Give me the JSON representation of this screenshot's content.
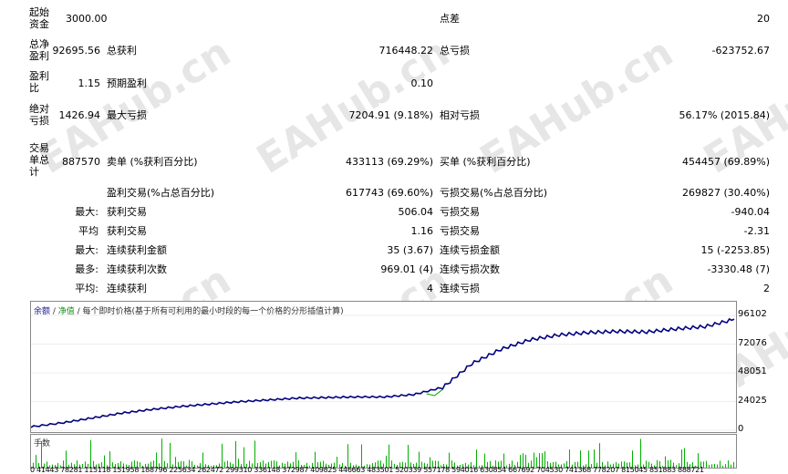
{
  "stats": {
    "initial_deposit_label": "起始资金",
    "initial_deposit": "3000.00",
    "spread_label": "点差",
    "spread": "20",
    "net_profit_label": "总净盈利",
    "net_profit": "92695.56",
    "gross_profit_label": "总获利",
    "gross_profit": "716448.22",
    "gross_loss_label": "总亏损",
    "gross_loss": "-623752.67",
    "profit_factor_label": "盈利比",
    "profit_factor": "1.15",
    "expected_payoff_label": "预期盈利",
    "expected_payoff": "0.10",
    "abs_drawdown_label": "绝对亏损",
    "abs_drawdown": "1426.94",
    "max_drawdown_label": "最大亏损",
    "max_drawdown": "7204.91 (9.18%)",
    "rel_drawdown_label": "相对亏损",
    "rel_drawdown": "56.17% (2015.84)",
    "total_trades_label": "交易单总计",
    "total_trades": "887570",
    "short_label": "卖单 (%获利百分比)",
    "short_value": "433113 (69.29%)",
    "long_label": "买单 (%获利百分比)",
    "long_value": "454457 (69.89%)",
    "profit_trades_label": "盈利交易(%占总百分比)",
    "profit_trades": "617743 (69.60%)",
    "loss_trades_label": "亏损交易(%占总百分比)",
    "loss_trades": "269827 (30.40%)",
    "largest_label": "最大:",
    "largest_profit_label": "获利交易",
    "largest_profit": "506.04",
    "largest_loss_label": "亏损交易",
    "largest_loss": "-940.04",
    "average_label": "平均",
    "average_profit_label": "获利交易",
    "average_profit": "1.16",
    "average_loss_label": "亏损交易",
    "average_loss": "-2.31",
    "max_label": "最大:",
    "max_consec_wins_label": "连续获利金额",
    "max_consec_wins": "35 (3.67)",
    "max_consec_losses_label": "连续亏损金额",
    "max_consec_losses": "15 (-2253.85)",
    "most_label": "最多:",
    "max_consec_profit_label": "连续获利次数",
    "max_consec_profit": "969.01 (4)",
    "max_consec_loss_label": "连续亏损次数",
    "max_consec_loss": "-3330.48 (7)",
    "avg2_label": "平均:",
    "avg_consec_wins_label": "连续获利",
    "avg_consec_wins": "4",
    "avg_consec_losses_label": "连续亏损",
    "avg_consec_losses": "2"
  },
  "legend": {
    "balance": "余额",
    "sep": " / ",
    "equity": "净值",
    "rest": " / 每个即时价格(基于所有可利用的最小时段的每一个价格的分形插值计算)"
  },
  "volume_label": "手数",
  "watermark": "EAHub.cn",
  "x_ticks_text": "0 41443 78281 115118 151958 188796 225634 262472 299310 336148 372987 409825 446663 483501 520339 557178 594016 630854 667692 704530 741368 778207 815045 851883 888721",
  "colors": {
    "balance": "#00007f",
    "equity": "#00a000",
    "volume": "#00b000"
  },
  "chart_data": {
    "type": "line",
    "ylim": [
      0,
      96102
    ],
    "yticks": [
      "96102",
      "72076",
      "48051",
      "24025",
      "0"
    ],
    "x": [
      0,
      41443,
      78281,
      115118,
      151958,
      188796,
      225634,
      262472,
      299310,
      336148,
      372987,
      409825,
      446663,
      483501,
      520339,
      557178,
      594016,
      630854,
      667692,
      704530,
      741368,
      778207,
      815045,
      851883,
      888721
    ],
    "series": [
      {
        "name": "余额",
        "values": [
          3000,
          6500,
          10500,
          14500,
          17500,
          20000,
          22000,
          24000,
          25500,
          27000,
          27500,
          28000,
          28000,
          30000,
          36000,
          56000,
          68000,
          76000,
          80000,
          82000,
          83000,
          82500,
          85000,
          87000,
          93000
        ]
      }
    ]
  }
}
